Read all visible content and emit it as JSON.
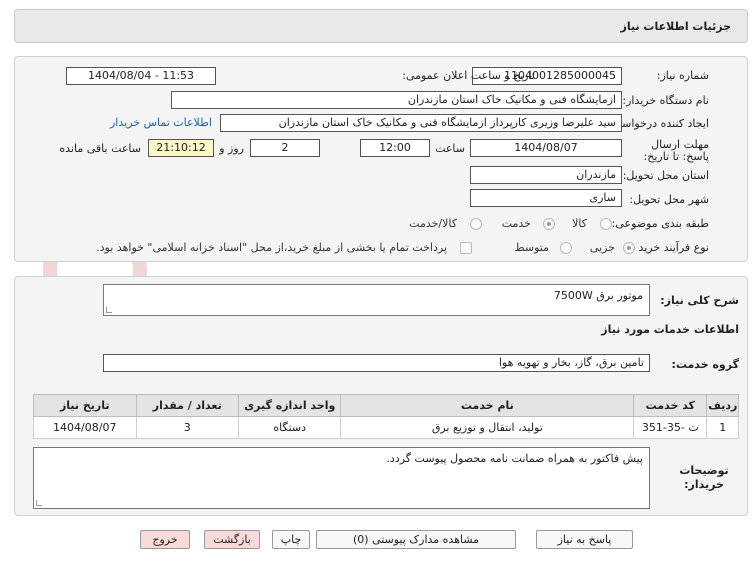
{
  "header": {
    "title": "جزئیات اطلاعات نیاز"
  },
  "info": {
    "need_number_label": "شماره نیاز:",
    "need_number": "1104001285000045",
    "announce_label": "تاریخ و ساعت اعلان عمومی:",
    "announce_value": "1404/08/04 - 11:53",
    "buyer_org_label": "نام دستگاه خریدار:",
    "buyer_org": "ازمایشگاه فنی و مکانیک خاک استان مازندران",
    "requester_label": "ایجاد کننده درخواست:",
    "requester": "سید علیرضا  وزیری  کارپرداز ازمایشگاه فنی و مکانیک خاک استان مازندران",
    "contact_link": "اطلاعات تماس خریدار",
    "deadline_label": "مهلت ارسال پاسخ: تا تاریخ:",
    "deadline_date": "1404/08/07",
    "time_label": "ساعت",
    "deadline_time": "12:00",
    "days_value": "2",
    "days_label": "روز و",
    "remaining_time": "21:10:12",
    "remaining_label": "ساعت باقی مانده",
    "province_label": "استان محل تحویل:",
    "province": "مازندران",
    "city_label": "شهر محل تحویل:",
    "city": "ساری",
    "category_label": "طبقه بندی موضوعی:",
    "category_options": [
      "کالا",
      "خدمت",
      "کالا/خدمت"
    ],
    "category_selected": "خدمت",
    "process_label": "نوع فرآیند خرید :",
    "process_options": [
      "جزیی",
      "متوسط"
    ],
    "process_selected": "جزیی",
    "payment_note": "پرداخت تمام یا بخشی از مبلغ خرید،از محل \"اسناد خزانه اسلامی\" خواهد بود."
  },
  "need": {
    "summary_label": "شرح کلی نیاز:",
    "summary": "موتور برق 7500W",
    "services_title": "اطلاعات خدمات مورد نیاز",
    "service_group_label": "گروه خدمت:",
    "service_group": "تامین برق، گاز، بخار و تهویه هوا"
  },
  "table": {
    "headers": [
      "ردیف",
      "کد خدمت",
      "نام خدمت",
      "واحد اندازه گیری",
      "تعداد / مقدار",
      "تاریخ نیاز"
    ],
    "rows": [
      [
        "1",
        "ت -35-351",
        "تولید، انتقال و توزیع برق",
        "دستگاه",
        "3",
        "1404/08/07"
      ]
    ]
  },
  "notes": {
    "label": "توضیحات خریدار:",
    "text": "پیش فاکتور  به همراه ضمانت نامه محصول پیوست گردد."
  },
  "buttons": {
    "reply": "پاسخ به نیاز",
    "attachments": "مشاهده مدارک پیوستی (0)",
    "print": "چاپ",
    "back": "بازگشت",
    "exit": "خروج"
  },
  "watermark": {
    "text": "AriaTender.net"
  },
  "colors": {
    "link": "#1a5fb4",
    "remaining_bg": "#fbf6c8",
    "pink_button": "#f9d9d9"
  }
}
